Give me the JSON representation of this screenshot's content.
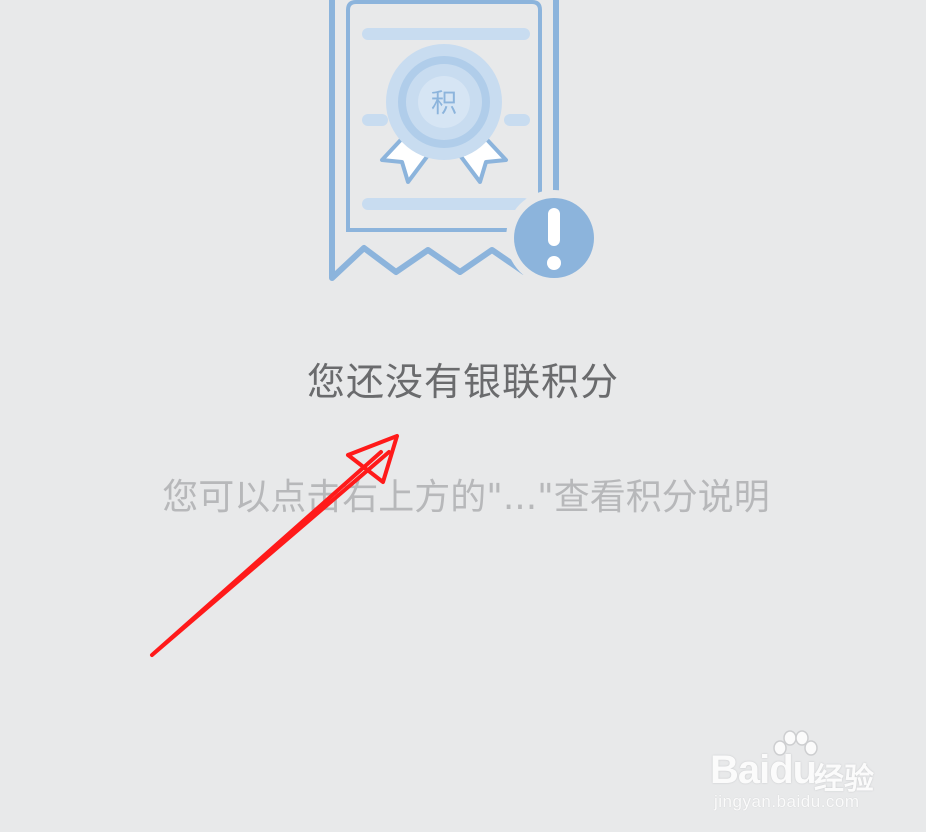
{
  "empty_state": {
    "icon_char": "积",
    "title": "您还没有银联积分",
    "hint": "您可以点击右上方的\"...\"查看积分说明"
  },
  "watermark": {
    "brand": "Baidu",
    "suffix": "经验",
    "url": "jingyan.baidu.com"
  },
  "colors": {
    "background": "#e8e9ea",
    "illustration_blue": "#8cb4dc",
    "illustration_light": "#c8dcf0",
    "title_text": "#6a6b6d",
    "hint_text": "#b7b8ba",
    "annotation_arrow": "#ff1a1a"
  },
  "icons": {
    "illustration": "points-certificate-icon",
    "alert_badge": "exclamation-icon",
    "annotation": "arrow-annotation"
  }
}
